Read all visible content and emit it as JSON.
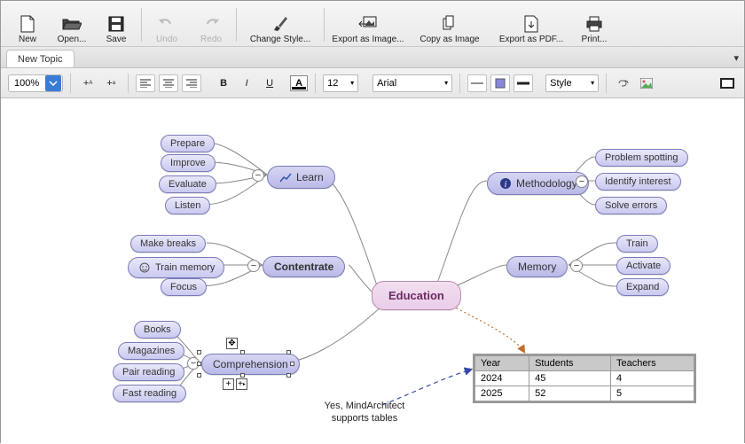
{
  "toolbar": {
    "new": "New",
    "open": "Open...",
    "save": "Save",
    "undo": "Undo",
    "redo": "Redo",
    "changeStyle": "Change Style...",
    "exportImage": "Export as Image...",
    "copyImage": "Copy as Image",
    "exportPdf": "Export as PDF...",
    "print": "Print..."
  },
  "tabs": [
    "New Topic"
  ],
  "format": {
    "zoom": "100%",
    "fontSize": "12",
    "fontName": "Arial",
    "styleLabel": "Style"
  },
  "map": {
    "center": "Education",
    "branches": {
      "learn": {
        "label": "Learn",
        "children": [
          "Prepare",
          "Improve",
          "Evaluate",
          "Listen"
        ]
      },
      "concentrate": {
        "label": "Contentrate",
        "children": [
          "Make breaks",
          "Train memory",
          "Focus"
        ]
      },
      "comprehension": {
        "label": "Comprehension",
        "children": [
          "Books",
          "Magazines",
          "Pair reading",
          "Fast reading"
        ]
      },
      "methodology": {
        "label": "Methodology",
        "children": [
          "Problem spotting",
          "Identify interest",
          "Solve errors"
        ]
      },
      "memory": {
        "label": "Memory",
        "children": [
          "Train",
          "Activate",
          "Expand"
        ]
      }
    }
  },
  "table": {
    "headers": [
      "Year",
      "Students",
      "Teachers"
    ],
    "rows": [
      [
        "2024",
        "45",
        "4"
      ],
      [
        "2025",
        "52",
        "5"
      ]
    ]
  },
  "caption": "Yes, MindArchitect\nsupports tables"
}
